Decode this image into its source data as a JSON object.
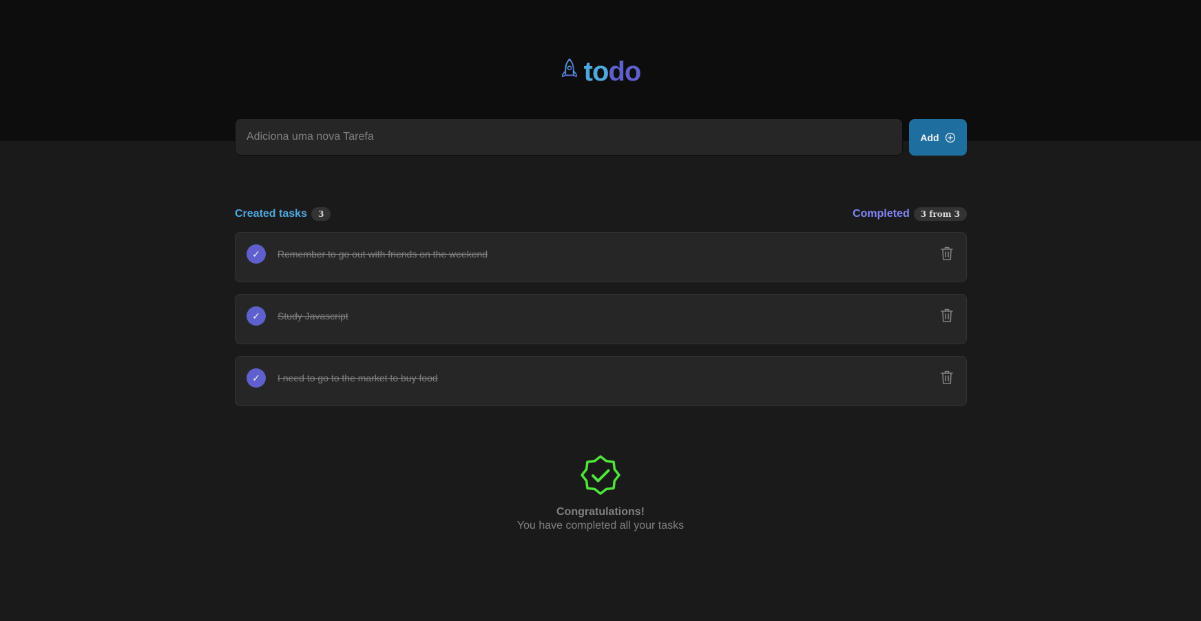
{
  "app": {
    "logo_part1": "to",
    "logo_part2": "do"
  },
  "new_task": {
    "placeholder": "Adiciona uma nova Tarefa",
    "value": "",
    "add_label": "Add",
    "add_icon": "plus-circle-icon"
  },
  "summary": {
    "created_label": "Created tasks",
    "created_count": "3",
    "completed_label": "Completed",
    "completed_count": "3 from 3"
  },
  "tasks": [
    {
      "text": "Remember to go out with friends on the weekend",
      "done": true
    },
    {
      "text": "Study Javascript",
      "done": true
    },
    {
      "text": "I need to go to the market to buy food",
      "done": true
    }
  ],
  "congrats": {
    "title": "Congratulations!",
    "subtitle": "You have completed all your tasks",
    "icon": "check-badge-icon"
  },
  "colors": {
    "blue": "#4ea8de",
    "purple": "#5e60ce",
    "add_button": "#1e6f9f",
    "success": "#4ee63a"
  }
}
